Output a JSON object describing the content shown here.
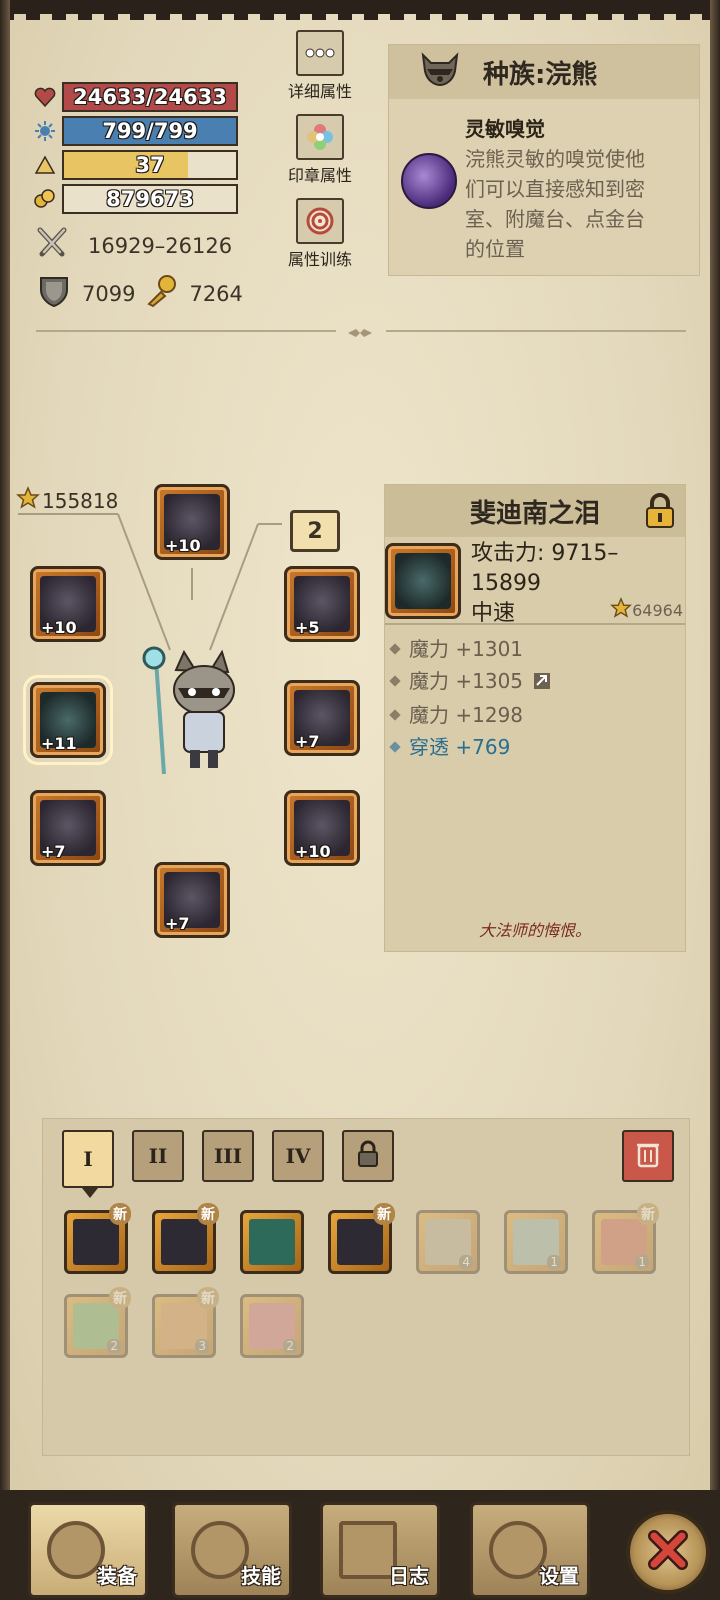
{
  "stats": {
    "hp": {
      "text": "24633/24633",
      "fill": 1.0,
      "color": "#b24a4a"
    },
    "mp": {
      "text": "799/799",
      "fill": 1.0,
      "color": "#4a7fb2"
    },
    "level": {
      "text": "37",
      "fill": 0.72,
      "color": "#e8c462"
    },
    "gold": {
      "text": "879673",
      "fill": 0.0,
      "color": "#e9e1c9"
    },
    "attack": "16929–26126",
    "armor": "7099",
    "magic_resist": "7264"
  },
  "side_buttons": {
    "detail": "详细属性",
    "seal": "印章属性",
    "training": "属性训练"
  },
  "race": {
    "title": "种族:浣熊",
    "trait_name": "灵敏嗅觉",
    "trait_desc_lines": [
      "浣熊灵敏的嗅觉使他",
      "们可以直接感知到密",
      "室、附魔台、点金台",
      "的位置"
    ]
  },
  "equipment": {
    "score": "155818",
    "counter": "2",
    "slots": {
      "helmet": "+10",
      "shoulder_left": "+10",
      "armor_right": "+5",
      "weapon": "+11",
      "ring_right": "+7",
      "gloves": "+7",
      "legs_right": "+10",
      "boots": "+7"
    }
  },
  "item_detail": {
    "name": "斐迪南之泪",
    "attack": "攻击力: 9715–15899",
    "speed": "中速",
    "score": "64964",
    "attrs": [
      "魔力 +1301",
      "魔力 +1305",
      "魔力 +1298"
    ],
    "special_attr": "穿透 +769",
    "flavor": "大法师的悔恨。"
  },
  "inventory": {
    "tabs": [
      "I",
      "II",
      "III",
      "IV"
    ],
    "new_label": "新",
    "counts": [
      "4",
      "1",
      "1",
      "2",
      "3",
      "2"
    ]
  },
  "nav": {
    "equip": "装备",
    "skills": "技能",
    "log": "日志",
    "settings": "设置"
  },
  "colors": {
    "accent_blue": "#2a6f8f",
    "parchment": "#e6dcc0",
    "frame_orange": "#c9792a"
  }
}
